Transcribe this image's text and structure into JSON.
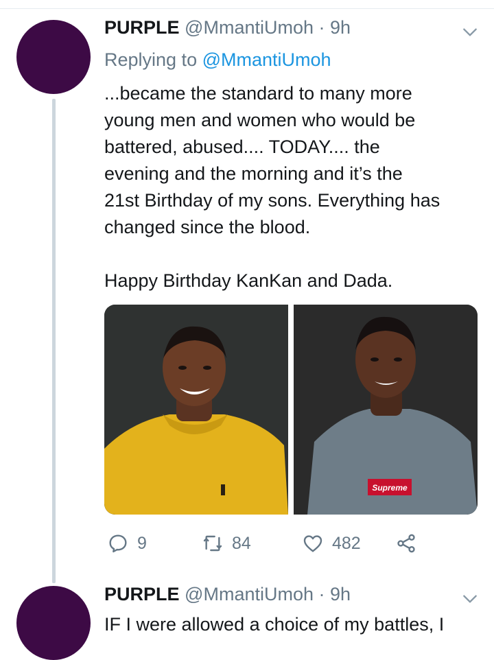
{
  "tweets": [
    {
      "display_name": "PURPLE",
      "handle": "@MmantiUmoh",
      "separator": "·",
      "time": "9h",
      "replying_prefix": "Replying to",
      "replying_handle": "@MmantiUmoh",
      "text_lines": [
        "...became the standard to many more",
        "young men and women who would be",
        "battered, abused.... TODAY.... the",
        "evening and the morning and it’s the",
        "21st Birthday of my sons. Everything has",
        "changed since the blood."
      ],
      "greeting": "Happy Birthday KanKan and Dada.",
      "photos": [
        {
          "description_icon": "photo-yellow-sweater"
        },
        {
          "description_icon": "photo-grey-sweater",
          "logo_text": "Supreme"
        }
      ],
      "actions": {
        "reply_count": "9",
        "retweet_count": "84",
        "like_count": "482"
      }
    },
    {
      "display_name": "PURPLE",
      "handle": "@MmantiUmoh",
      "separator": "·",
      "time": "9h",
      "text": "IF I were allowed a choice of my battles, I"
    }
  ],
  "colors": {
    "avatar": "#3d0a45",
    "link": "#1b95e0",
    "muted": "#657786",
    "thread_line": "#ccd6dd"
  }
}
